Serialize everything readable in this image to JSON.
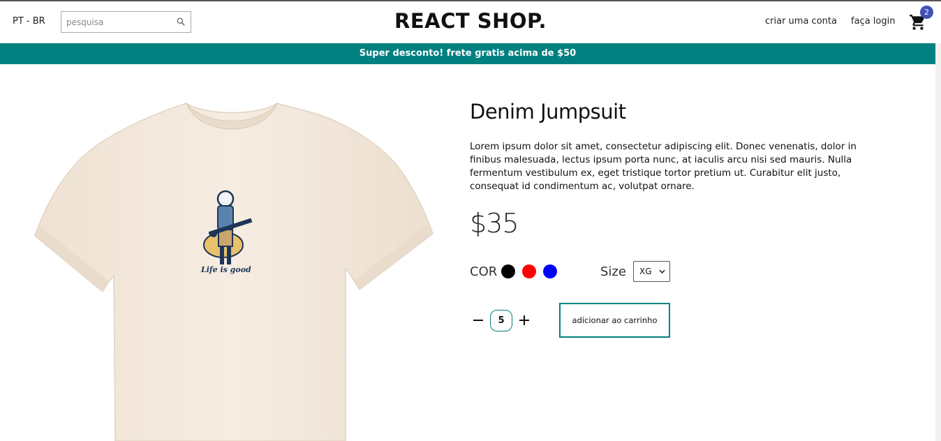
{
  "navbar": {
    "language": "PT - BR",
    "search": {
      "placeholder": "pesquisa",
      "value": "",
      "icon": "search-icon"
    },
    "brand": "REACT SHOP.",
    "links": {
      "register": "criar uma conta",
      "login": "faça login"
    },
    "cart": {
      "icon": "cart-icon",
      "badge_count": "2",
      "badge_color": "#3f51b5"
    }
  },
  "announcement": {
    "text": "Super desconto! frete gratis acima de $50",
    "background": "#008080"
  },
  "product": {
    "image_alt": "Life is good t-shirt",
    "title": "Denim Jumpsuit",
    "description": "Lorem ipsum dolor sit amet, consectetur adipiscing elit. Donec venenatis, dolor in finibus malesuada, lectus ipsum porta nunc, at iaculis arcu nisi sed mauris. Nulla fermentum vestibulum ex, eget tristique tortor pretium ut. Curabitur elit justo, consequat id condimentum ac, volutpat ornare.",
    "price": "$35",
    "color_label": "COR",
    "colors": [
      "#000000",
      "#ff0000",
      "#0000ff"
    ],
    "size_label": "Size",
    "size_selected": "XG",
    "quantity": "5",
    "add_to_cart_label": "adicionar ao carrinho",
    "shirt_print_text": "Life is good"
  }
}
